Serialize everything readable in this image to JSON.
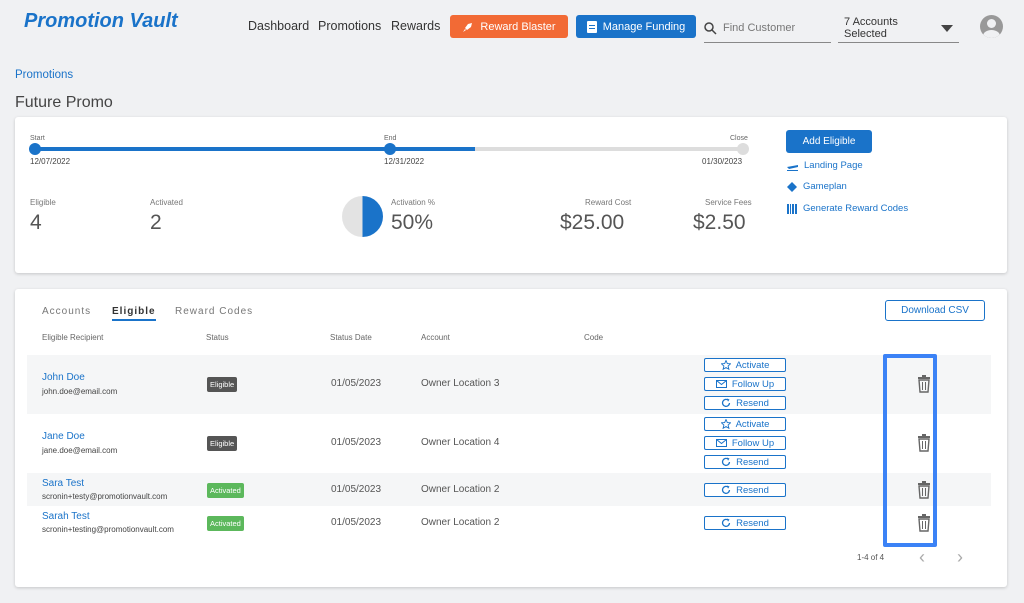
{
  "header": {
    "logo": "Promotion Vault",
    "nav": [
      "Dashboard",
      "Promotions",
      "Rewards"
    ],
    "reward_blaster": "Reward Blaster",
    "manage_funding": "Manage Funding",
    "search_placeholder": "Find Customer",
    "accounts_selected": "7 Accounts Selected"
  },
  "breadcrumb": "Promotions",
  "page_title": "Future Promo",
  "timeline": {
    "start_label": "Start",
    "start_date": "12/07/2022",
    "end_label": "End",
    "end_date": "12/31/2022",
    "close_label": "Close",
    "close_date": "01/30/2023",
    "progress_fraction": 0.62
  },
  "stats": {
    "eligible_label": "Eligible",
    "eligible": "4",
    "activated_label": "Activated",
    "activated": "2",
    "activation_label": "Activation %",
    "activation": "50%",
    "activation_fraction": 0.5,
    "reward_cost_label": "Reward Cost",
    "reward_cost": "$25.00",
    "service_fees_label": "Service Fees",
    "service_fees": "$2.50"
  },
  "side_actions": {
    "add_eligible": "Add Eligible",
    "landing_page": "Landing Page",
    "gameplan": "Gameplan",
    "generate_codes": "Generate Reward Codes"
  },
  "tabs": [
    "Accounts",
    "Eligible",
    "Reward Codes"
  ],
  "download_csv": "Download CSV",
  "columns": [
    "Eligible Recipient",
    "Status",
    "Status Date",
    "Account",
    "Code"
  ],
  "rows": [
    {
      "name": "John Doe",
      "email": "john.doe@email.com",
      "status": "Eligible",
      "date": "01/05/2023",
      "account": "Owner Location 3",
      "actions": [
        "Activate",
        "Follow Up",
        "Resend"
      ]
    },
    {
      "name": "Jane Doe",
      "email": "jane.doe@email.com",
      "status": "Eligible",
      "date": "01/05/2023",
      "account": "Owner Location 4",
      "actions": [
        "Activate",
        "Follow Up",
        "Resend"
      ]
    },
    {
      "name": "Sara Test",
      "email": "scronin+testy@promotionvault.com",
      "status": "Activated",
      "date": "01/05/2023",
      "account": "Owner Location 2",
      "actions": [
        "Resend"
      ]
    },
    {
      "name": "Sarah Test",
      "email": "scronin+testing@promotionvault.com",
      "status": "Activated",
      "date": "01/05/2023",
      "account": "Owner Location 2",
      "actions": [
        "Resend"
      ]
    }
  ],
  "pagination": "1-4 of 4",
  "colors": {
    "primary": "#1a73c9",
    "orange": "#f26a35",
    "eligible_badge": "#555555",
    "activated_badge": "#5cb85c",
    "highlight": "#3b82f6"
  }
}
